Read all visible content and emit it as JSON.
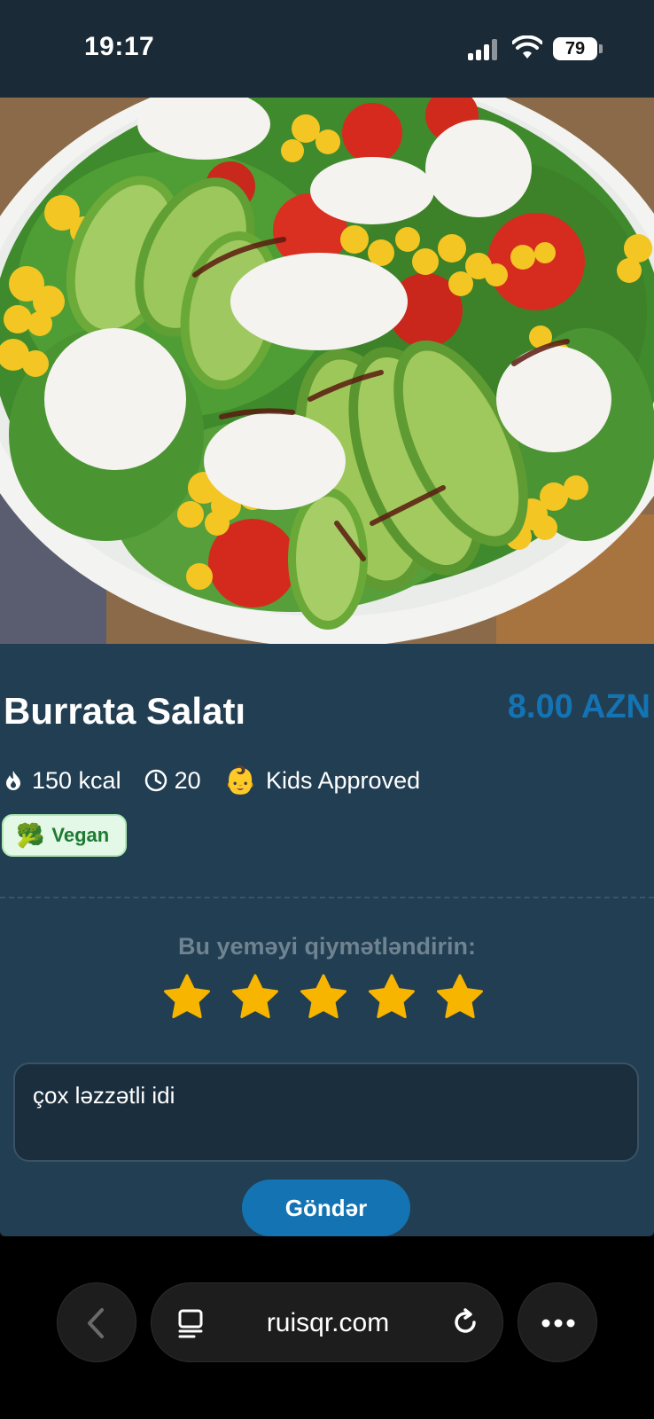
{
  "status_bar": {
    "time": "19:17",
    "battery": "79"
  },
  "hero": {
    "icon": "salad-photo"
  },
  "dish": {
    "name": "Burrata Salatı",
    "price": "8.00 AZN",
    "calories": "150 kcal",
    "time": "20",
    "kids_label": "Kids Approved",
    "kids_emoji": "👶",
    "badge_label": "Vegan",
    "badge_emoji": "🥦"
  },
  "rating": {
    "label": "Bu yeməyi qiymətləndirin:",
    "stars_total": 5,
    "stars_selected": 5,
    "star_color": "#f7b500"
  },
  "comment": {
    "value": "çox ləzzətli idi"
  },
  "submit": {
    "label": "Göndər"
  },
  "browser": {
    "url": "ruisqr.com"
  },
  "colors": {
    "card": "#223e52",
    "price": "#1473b3",
    "button": "#1474b3",
    "badge_bg": "#e3f8e6",
    "badge_text": "#1f7a34"
  }
}
